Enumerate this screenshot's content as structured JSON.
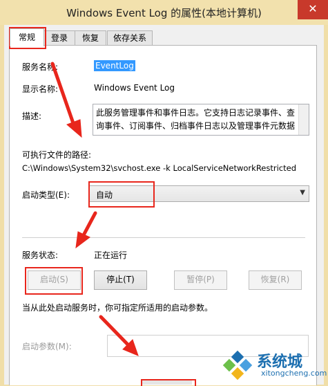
{
  "window": {
    "title": "Windows Event Log 的属性(本地计算机)",
    "close_glyph": "✕"
  },
  "tabs": [
    {
      "label": "常规",
      "active": true
    },
    {
      "label": "登录",
      "active": false
    },
    {
      "label": "恢复",
      "active": false
    },
    {
      "label": "依存关系",
      "active": false
    }
  ],
  "general": {
    "service_name_label": "服务名称:",
    "service_name_value": "EventLog",
    "display_name_label": "显示名称:",
    "display_name_value": "Windows Event Log",
    "description_label": "描述:",
    "description_value": "此服务管理事件和事件日志。它支持日志记录事件、查询事件、订阅事件、归档事件日志以及管理事件元数据",
    "exe_path_label": "可执行文件的路径:",
    "exe_path_value": "C:\\Windows\\System32\\svchost.exe -k LocalServiceNetworkRestricted",
    "startup_type_label": "启动类型(E):",
    "startup_type_value": "自动",
    "service_status_label": "服务状态:",
    "service_status_value": "正在运行",
    "buttons": {
      "start": "启动(S)",
      "stop": "停止(T)",
      "pause": "暂停(P)",
      "resume": "恢复(R)"
    },
    "hint_text": "当从此处启动服务时，你可指定所适用的启动参数。",
    "start_params_label": "启动参数(M):",
    "start_params_value": ""
  },
  "watermark": {
    "brand": "系统城",
    "site": "xitongcheng.com"
  },
  "colors": {
    "annotation_red": "#e8261c",
    "selection_blue": "#3399ff",
    "title_bar": "#f2e1ad",
    "close_button": "#c8392b"
  }
}
